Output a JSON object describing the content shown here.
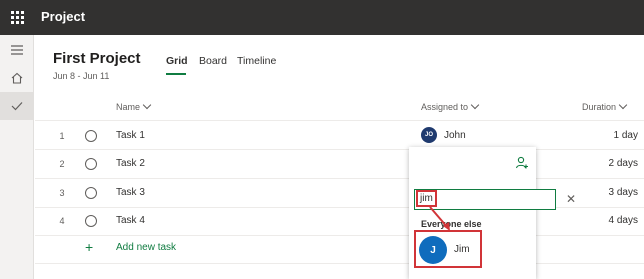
{
  "app": {
    "title": "Project"
  },
  "project": {
    "title": "First Project",
    "dates": "Jun 8 - Jun 11"
  },
  "tabs": [
    {
      "label": "Grid",
      "active": true
    },
    {
      "label": "Board",
      "active": false
    },
    {
      "label": "Timeline",
      "active": false
    }
  ],
  "columns": {
    "name": "Name",
    "assigned": "Assigned to",
    "duration": "Duration"
  },
  "tasks": [
    {
      "num": "1",
      "name": "Task 1",
      "duration": "1 day"
    },
    {
      "num": "2",
      "name": "Task 2",
      "duration": "2 days"
    },
    {
      "num": "3",
      "name": "Task 3",
      "duration": "3 days"
    },
    {
      "num": "4",
      "name": "Task 4",
      "duration": "4 days"
    }
  ],
  "assignee": {
    "initials": "JO",
    "name": "John"
  },
  "add_task": "Add new task",
  "picker": {
    "search_value": "jim",
    "group_label": "Everyone else",
    "option": {
      "initials": "J",
      "name": "Jim"
    }
  },
  "colors": {
    "accent": "#107c41",
    "highlight": "#d13438",
    "topbar": "#323130",
    "avatar_blue": "#0f6cbd"
  },
  "icons": [
    "waffle-icon",
    "hamburger-icon",
    "home-icon",
    "checkmark-icon",
    "add-person-icon",
    "clear-icon",
    "chevron-down-icon",
    "plus-icon"
  ]
}
